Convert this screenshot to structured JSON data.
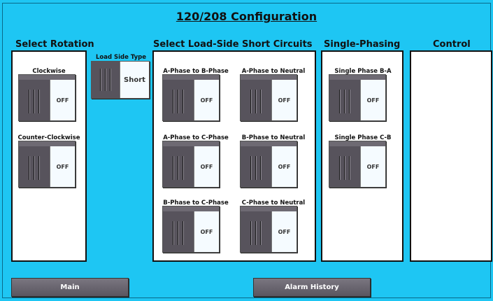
{
  "title": "120/208 Configuration",
  "sections": {
    "rotation": "Select Rotation",
    "load_side": "Select Load-Side Short Circuits",
    "single_phasing": "Single-Phasing",
    "control": "Control"
  },
  "load_side_type": {
    "label": "Load Side Type",
    "state": "Short"
  },
  "rotation_switches": [
    {
      "label": "Clockwise",
      "state": "OFF"
    },
    {
      "label": "Counter-Clockwise",
      "state": "OFF"
    }
  ],
  "short_circuit_switches": [
    {
      "label": "A-Phase to B-Phase",
      "state": "OFF"
    },
    {
      "label": "A-Phase to Neutral",
      "state": "OFF"
    },
    {
      "label": "A-Phase to C-Phase",
      "state": "OFF"
    },
    {
      "label": "B-Phase to Neutral",
      "state": "OFF"
    },
    {
      "label": "B-Phase to C-Phase",
      "state": "OFF"
    },
    {
      "label": "C-Phase to Neutral",
      "state": "OFF"
    }
  ],
  "single_phase_switches": [
    {
      "label": "Single Phase B-A",
      "state": "OFF"
    },
    {
      "label": "Single Phase C-B",
      "state": "OFF"
    }
  ],
  "buttons": {
    "main": "Main",
    "alarm_history": "Alarm History"
  },
  "colors": {
    "background": "#1ec6f3",
    "panel": "#ffffff",
    "switch_body": "#5a5560",
    "switch_state": "#f5fbff"
  }
}
